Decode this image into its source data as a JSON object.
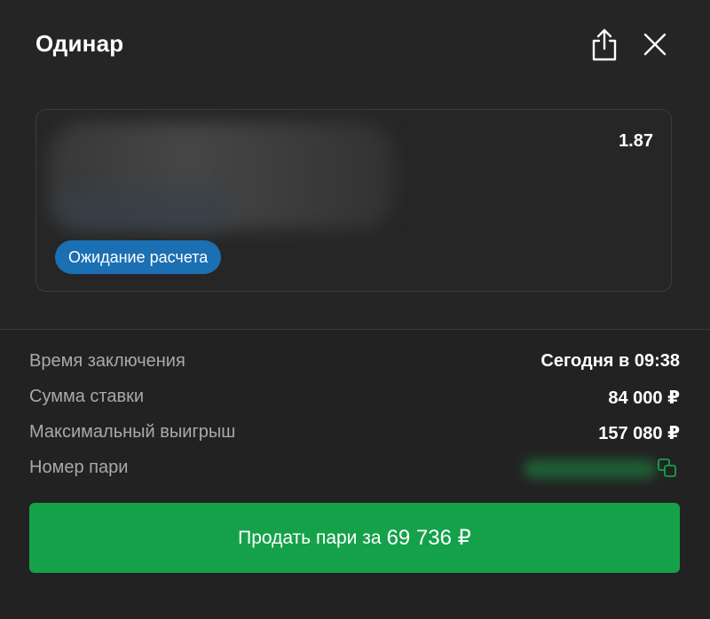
{
  "header": {
    "title": "Одинар",
    "share_icon": "share-icon",
    "close_icon": "close-icon"
  },
  "bet_card": {
    "odds": "1.87",
    "status": "Ожидание расчета"
  },
  "details": {
    "rows": [
      {
        "label": "Время заключения",
        "value": "Сегодня в 09:38"
      },
      {
        "label": "Сумма ставки",
        "value": "84 000 ₽"
      },
      {
        "label": "Максимальный выигрыш",
        "value": "157 080 ₽"
      },
      {
        "label": "Номер пари",
        "value": ""
      }
    ],
    "copy_icon": "copy-icon"
  },
  "sell": {
    "label": "Продать пари за",
    "amount": "69 736 ₽"
  },
  "colors": {
    "background": "#252525",
    "status_badge": "#1b6fb3",
    "accent_green": "#15a14a",
    "label_gray": "#a9a9a9"
  }
}
